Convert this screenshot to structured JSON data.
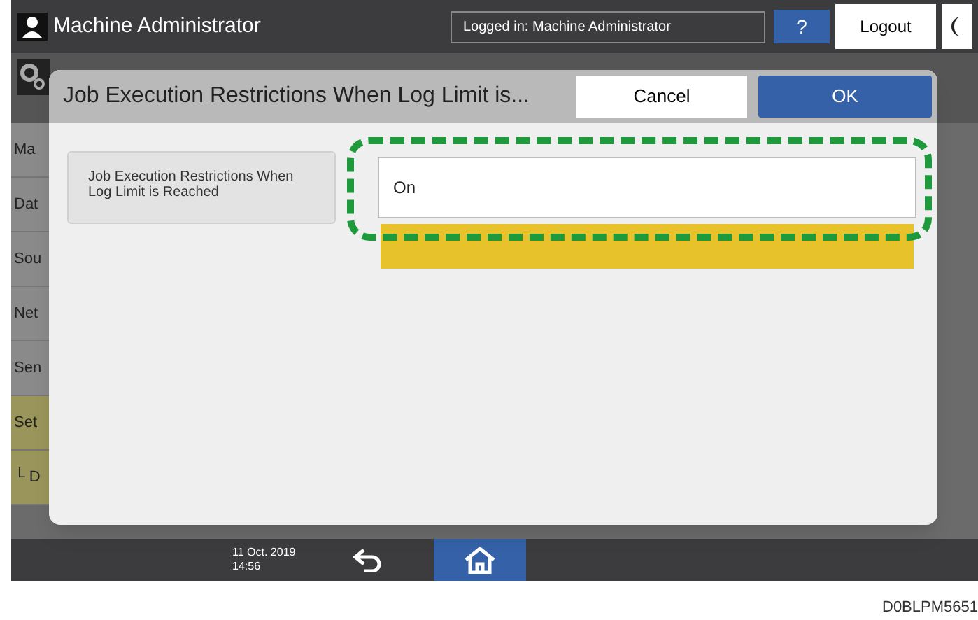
{
  "header": {
    "title": "Machine Administrator",
    "login_status": "Logged in: Machine Administrator",
    "help": "?",
    "logout": "Logout"
  },
  "sidebar": {
    "items": [
      {
        "label": "Ma",
        "selected": false
      },
      {
        "label": "Dat",
        "selected": false
      },
      {
        "label": "Sou",
        "selected": false
      },
      {
        "label": "Net",
        "selected": false
      },
      {
        "label": "Sen",
        "selected": false
      },
      {
        "label": "Set",
        "selected": true
      },
      {
        "label": "└ D",
        "selected": true
      }
    ]
  },
  "dialog": {
    "title": "Job Execution Restrictions When Log Limit is...",
    "cancel": "Cancel",
    "ok": "OK",
    "setting": {
      "label": "Job Execution Restrictions When Log Limit is Reached",
      "value": "On",
      "highlighted": true
    }
  },
  "footer": {
    "date": "11 Oct. 2019",
    "time": "14:56"
  },
  "caption": "D0BLPM5651"
}
